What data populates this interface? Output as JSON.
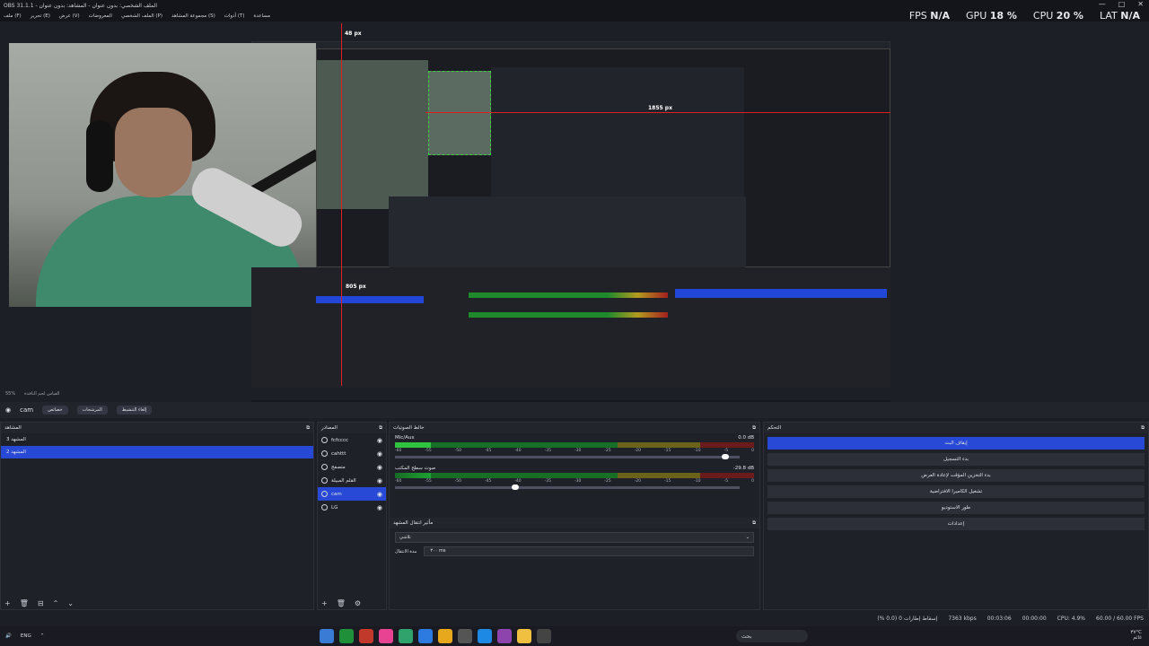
{
  "window": {
    "title": "OBS 31.1.1 - الملف الشخصي: بدون عنوان - المشاهد: بدون عنوان",
    "controls": [
      "—",
      "□",
      "✕"
    ]
  },
  "menu": [
    "ملف (F)",
    "تحرير (E)",
    "عرض (V)",
    "المعروضات",
    "الملف الشخصي (P)",
    "مجموعة المشاهد (S)",
    "أدوات (T)",
    "مساعدة"
  ],
  "stats": {
    "fps_label": "FPS",
    "fps": "N/A",
    "gpu_label": "GPU",
    "gpu": "18 %",
    "cpu_label": "CPU",
    "cpu": "20 %",
    "lat_label": "LAT",
    "lat": "N/A"
  },
  "preview": {
    "measure_top": "48 px",
    "measure_right": "1855 px",
    "measure_bottom": "805 px"
  },
  "toolbar_row": {
    "zoom": "55%",
    "mode": "القياس لجم النافذة"
  },
  "source_bar": {
    "current_source": "cam",
    "filters_button": "خصائص",
    "properties_button": "المرشحات",
    "deactivate_button": "إلغاء التنشيط"
  },
  "scenes": {
    "title": "المشاهد",
    "items": [
      {
        "label": "المشهد 3",
        "selected": false
      },
      {
        "label": "المشهد 2",
        "selected": true
      }
    ]
  },
  "sources": {
    "title": "المصادر",
    "items": [
      {
        "label": "fcfcccc",
        "selected": false
      },
      {
        "label": "cahttt",
        "selected": false
      },
      {
        "label": "متصفح",
        "selected": false
      },
      {
        "label": "القلم المبيلة",
        "selected": false
      },
      {
        "label": "cam",
        "selected": true
      },
      {
        "label": "LG",
        "selected": false
      }
    ]
  },
  "mixer": {
    "title": "خالط الصوتيات",
    "channels": [
      {
        "name": "Mic/Aux",
        "db": "0.0 dB",
        "level": 0.1,
        "vol": 0.97
      },
      {
        "name": "صوت سطح المكتب",
        "db": "-29.8 dB",
        "level": 0.0,
        "vol": 0.36
      }
    ],
    "scale": [
      "-60",
      "-55",
      "-50",
      "-45",
      "-40",
      "-35",
      "-30",
      "-25",
      "-20",
      "-15",
      "-10",
      "-5",
      "0"
    ]
  },
  "transitions": {
    "title": "مأثير انتقال المشهد",
    "selected": "تلاشي",
    "duration_label": "مدة الانتقال",
    "duration_value": "٣٠٠ ms"
  },
  "controls": {
    "title": "التحكم",
    "buttons": [
      {
        "label": "إيقاف البث",
        "primary": true
      },
      {
        "label": "بدء التسجيل",
        "primary": false
      },
      {
        "label": "بدء التخزين المؤقت لإعادة العرض",
        "primary": false
      },
      {
        "label": "تشغيل الكاميرا الافتراضية",
        "primary": false
      },
      {
        "label": "طور الاستوديو",
        "primary": false
      },
      {
        "label": "إعدادات",
        "primary": false
      }
    ]
  },
  "status": {
    "dropped": "إسقاط إطارات 0 (0.0 %)",
    "bitrate": "7363 kbps",
    "live_time": "00:03:06",
    "rec_time": "00:00:00",
    "cpu": "CPU: 4.9%",
    "fps": "60.00 / 60.00 FPS"
  },
  "taskbar": {
    "lang": "ENG",
    "search": "بحث",
    "time": "٣٧°C",
    "weather": "غائم"
  }
}
